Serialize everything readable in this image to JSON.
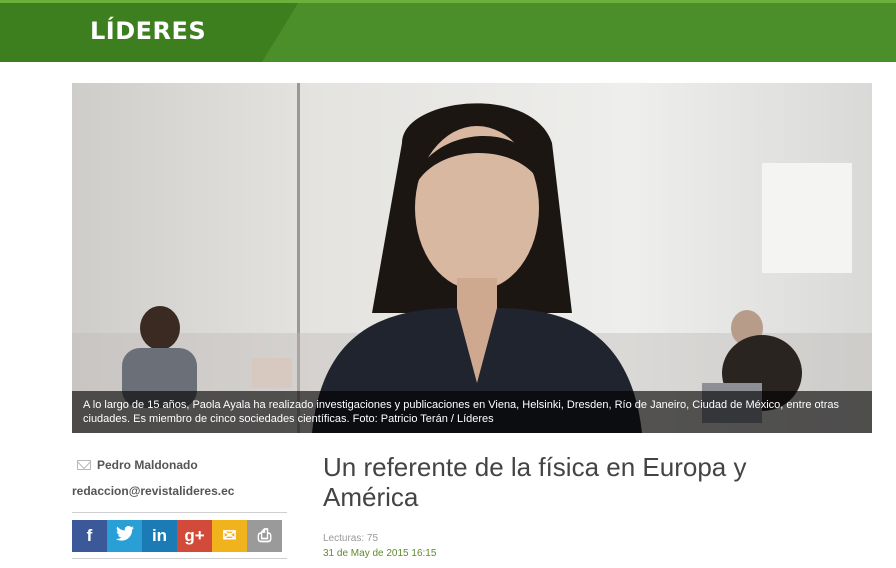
{
  "header": {
    "logo": "LÍDERES"
  },
  "photo": {
    "caption": "A lo largo de 15 años, Paola Ayala ha realizado investigaciones y publicaciones en Viena, Helsinki, Dresden, Río de Janeiro, Ciudad de México, entre otras ciudades. Es miembro de cinco sociedades científicas. Foto: Patricio Terán / Líderes"
  },
  "author": {
    "name": "Pedro Maldonado",
    "email": "redaccion@revistalideres.ec",
    "icon": "mail-icon"
  },
  "share": [
    {
      "name": "facebook",
      "glyph": "f",
      "color": "#3b5998"
    },
    {
      "name": "twitter",
      "glyph": "🐦",
      "color": "#2a9fd6"
    },
    {
      "name": "linkedin",
      "glyph": "in",
      "color": "#1b7cb5"
    },
    {
      "name": "googleplus",
      "glyph": "g+",
      "color": "#d24a3a"
    },
    {
      "name": "email",
      "glyph": "✉",
      "color": "#f0b21d"
    },
    {
      "name": "print",
      "glyph": "⎙",
      "color": "#9a9a9a"
    }
  ],
  "article": {
    "title": "Un referente de la física en Europa y América",
    "reads": "Lecturas: 75",
    "date": "31 de May de 2015 16:15"
  }
}
